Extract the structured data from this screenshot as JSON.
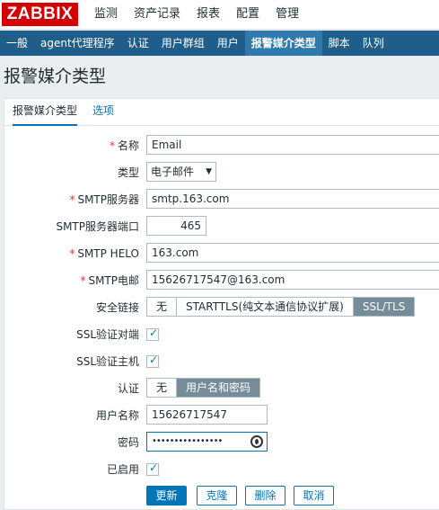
{
  "logo": "ZABBIX",
  "main_nav": [
    "监测",
    "资产记录",
    "报表",
    "配置",
    "管理"
  ],
  "sub_nav": [
    "一般",
    "agent代理程序",
    "认证",
    "用户群组",
    "用户",
    "报警媒介类型",
    "脚本",
    "队列"
  ],
  "page_title": "报警媒介类型",
  "tabs": [
    "报警媒介类型",
    "选项"
  ],
  "form": {
    "name": {
      "label": "名称",
      "value": "Email",
      "required": "*"
    },
    "type": {
      "label": "类型",
      "value": "电子邮件",
      "caret": "▼"
    },
    "smtp_server": {
      "label": "SMTP服务器",
      "value": "smtp.163.com",
      "required": "*"
    },
    "smtp_port": {
      "label": "SMTP服务器端口",
      "value": "465"
    },
    "smtp_helo": {
      "label": "SMTP HELO",
      "value": "163.com",
      "required": "*"
    },
    "smtp_email": {
      "label": "SMTP电邮",
      "value": "15626717547@163.com",
      "required": "*"
    },
    "security": {
      "label": "安全链接",
      "options": [
        "无",
        "STARTTLS(纯文本通信协议扩展)",
        "SSL/TLS"
      ],
      "selected": "SSL/TLS"
    },
    "ssl_verify_peer": {
      "label": "SSL验证对端",
      "checked": true
    },
    "ssl_verify_host": {
      "label": "SSL验证主机",
      "checked": true
    },
    "auth": {
      "label": "认证",
      "options": [
        "无",
        "用户名和密码"
      ],
      "selected": "用户名和密码"
    },
    "username": {
      "label": "用户名称",
      "value": "15626717547"
    },
    "password": {
      "label": "密码",
      "value": "••••••••••••••••"
    },
    "enabled": {
      "label": "已启用",
      "checked": true
    }
  },
  "buttons": {
    "update": "更新",
    "clone": "克隆",
    "delete": "删除",
    "cancel": "取消"
  },
  "colors": {
    "brand": "#d40000",
    "subnav": "#1f5e8a",
    "accent": "#0275b8",
    "selected_segment": "#768d99",
    "required": "#e33734"
  },
  "icons": {
    "checkmark": "check-icon",
    "eye": "show-password-icon",
    "caret": "chevron-down-icon"
  }
}
